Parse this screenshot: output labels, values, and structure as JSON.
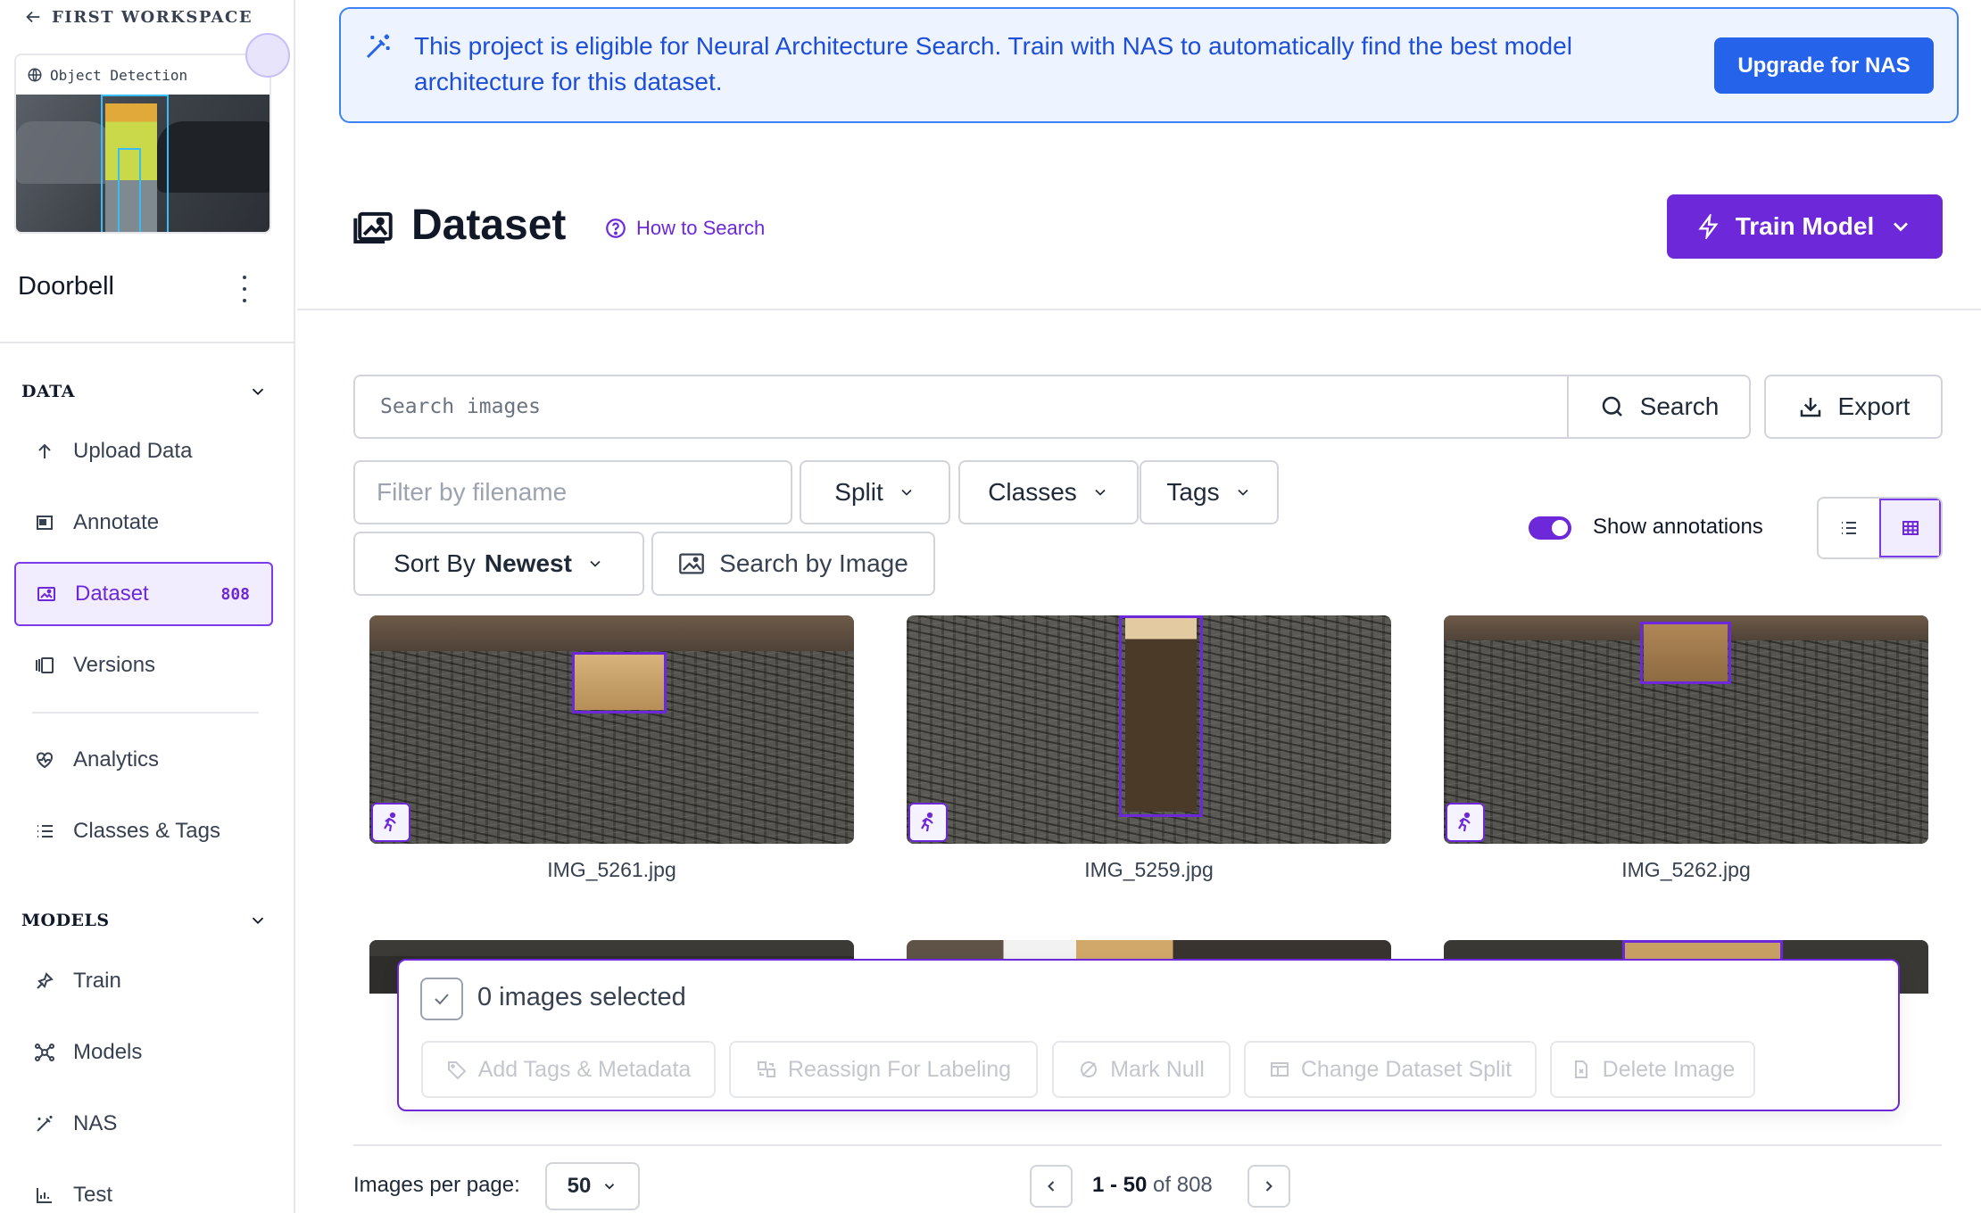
{
  "sidebar": {
    "workspace_back": "FIRST WORKSPACE",
    "project_type": "Object Detection",
    "project_name": "Doorbell",
    "sections": {
      "data": "DATA",
      "models": "MODELS"
    },
    "data_items": [
      {
        "label": "Upload Data",
        "icon": "arrow-up-icon"
      },
      {
        "label": "Annotate",
        "icon": "annotate-icon"
      },
      {
        "label": "Dataset",
        "icon": "image-icon",
        "count": "808",
        "active": true
      },
      {
        "label": "Versions",
        "icon": "versions-icon"
      },
      {
        "label": "Analytics",
        "icon": "analytics-icon"
      },
      {
        "label": "Classes & Tags",
        "icon": "list-icon"
      }
    ],
    "model_items": [
      {
        "label": "Train",
        "icon": "train-icon"
      },
      {
        "label": "Models",
        "icon": "models-icon"
      },
      {
        "label": "NAS",
        "icon": "magic-wand-icon"
      },
      {
        "label": "Test",
        "icon": "chart-icon"
      }
    ]
  },
  "banner": {
    "text": "This project is eligible for Neural Architecture Search. Train with NAS to automatically find the best model architecture for this dataset.",
    "button": "Upgrade for NAS"
  },
  "header": {
    "title": "Dataset",
    "how_to": "How to Search",
    "train_button": "Train Model"
  },
  "search": {
    "placeholder": "Search images",
    "button": "Search",
    "export": "Export"
  },
  "filters": {
    "filename_placeholder": "Filter by filename",
    "split": "Split",
    "classes": "Classes",
    "tags": "Tags",
    "sort_label": "Sort By",
    "sort_value": "Newest",
    "search_by_image": "Search by Image",
    "show_annotations": "Show annotations",
    "show_annotations_on": true,
    "view_mode": "grid"
  },
  "images": [
    {
      "name": "IMG_5261.jpg"
    },
    {
      "name": "IMG_5259.jpg"
    },
    {
      "name": "IMG_5262.jpg"
    }
  ],
  "selection": {
    "count_text": "0 images selected",
    "actions": [
      "Add Tags & Metadata",
      "Reassign For Labeling",
      "Mark Null",
      "Change Dataset Split",
      "Delete Image"
    ]
  },
  "pagination": {
    "per_page_label": "Images per page:",
    "per_page": "50",
    "range": "1 - 50",
    "of": "of",
    "total": "808"
  },
  "colors": {
    "accent": "#6d28d9",
    "banner_blue": "#2563eb",
    "banner_bg": "#eef4ff"
  }
}
